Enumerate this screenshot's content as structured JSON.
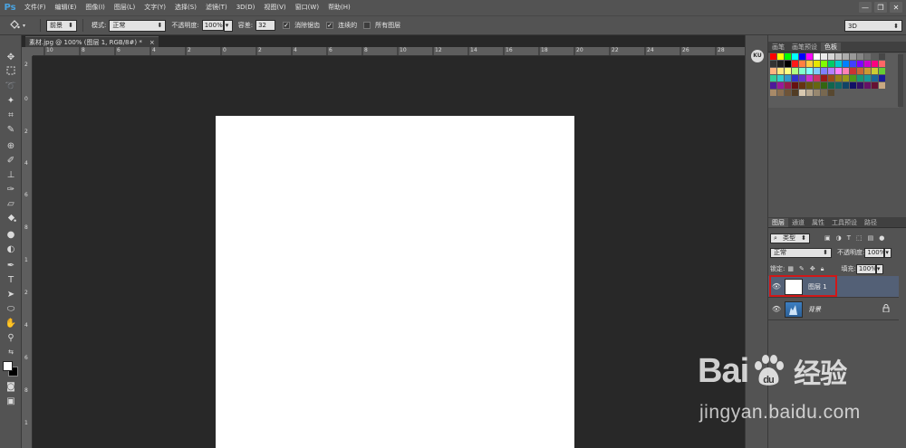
{
  "app": {
    "logo": "Ps"
  },
  "menu": [
    "文件(F)",
    "编辑(E)",
    "图像(I)",
    "图层(L)",
    "文字(Y)",
    "选择(S)",
    "滤镜(T)",
    "3D(D)",
    "视图(V)",
    "窗口(W)",
    "帮助(H)"
  ],
  "window_controls": {
    "minimize": "—",
    "restore": "❐",
    "close": "✕"
  },
  "options": {
    "fill_source": "前景",
    "mode_label": "模式:",
    "mode_value": "正常",
    "opacity_label": "不透明度:",
    "opacity_value": "100%",
    "tolerance_label": "容差:",
    "tolerance_value": "32",
    "antialias_label": "消除锯齿",
    "contiguous_label": "连续的",
    "all_layers_label": "所有图层",
    "workspace": "3D"
  },
  "document": {
    "tab_title": "素材.jpg @ 100% (图层 1, RGB/8#) *",
    "tab_close": "×",
    "ruler_top": [
      "10",
      "8",
      "6",
      "4",
      "2",
      "0",
      "2",
      "4",
      "6",
      "8",
      "10",
      "12",
      "14",
      "16",
      "18",
      "20",
      "22",
      "24",
      "26",
      "28"
    ],
    "ruler_left": [
      "2",
      "0",
      "2",
      "4",
      "6",
      "8",
      "1",
      "2",
      "4",
      "6",
      "8",
      "1"
    ]
  },
  "strip": {
    "button": "KU"
  },
  "swatches_panel": {
    "tabs": [
      "画笔",
      "画笔预设",
      "色板"
    ],
    "active_tab": "色板",
    "colors": [
      "#ff0000",
      "#ffff00",
      "#00ff00",
      "#00ffff",
      "#0000ff",
      "#ff00ff",
      "#ffffff",
      "#ebebeb",
      "#d6d6d6",
      "#c2c2c2",
      "#adadad",
      "#999999",
      "#858585",
      "#707070",
      "#5c5c5c",
      "#474747",
      "#333333",
      "#1f1f1f",
      "#000000",
      "#ff1a1a",
      "#ff8040",
      "#ffcc40",
      "#e6e600",
      "#80ff00",
      "#00cc66",
      "#00cccc",
      "#0080ff",
      "#4040ff",
      "#8000ff",
      "#cc00cc",
      "#ff0080",
      "#ff6666",
      "#ffb380",
      "#ffe680",
      "#ffff80",
      "#b3ff80",
      "#80ffcc",
      "#80ffff",
      "#80ccff",
      "#8080ff",
      "#b380ff",
      "#ff80ff",
      "#ff80b3",
      "#cc3333",
      "#cc6633",
      "#cc9933",
      "#cccc33",
      "#66cc33",
      "#33cc99",
      "#33cccc",
      "#3399cc",
      "#3333cc",
      "#6633cc",
      "#cc33cc",
      "#cc3366",
      "#991a1a",
      "#994d1a",
      "#99801a",
      "#99991a",
      "#4d991a",
      "#1a9973",
      "#1a9999",
      "#1a6699",
      "#1a1a99",
      "#4d1a99",
      "#991a99",
      "#991a4d",
      "#661111",
      "#663311",
      "#665511",
      "#666611",
      "#336611",
      "#11664d",
      "#116666",
      "#114466",
      "#111166",
      "#331166",
      "#661166",
      "#661133",
      "#c8a882",
      "#a88a68",
      "#8a6e50",
      "#6e5438",
      "#523c24",
      "#d8c8b0",
      "#b8a890",
      "#988870",
      "#786850",
      "#584830"
    ]
  },
  "layers_panel": {
    "tabs": [
      "图层",
      "通道",
      "属性",
      "工具预设",
      "路径"
    ],
    "active_tab": "图层",
    "filter_label": "类型",
    "blend_mode": "正常",
    "opacity_label": "不透明度:",
    "opacity_value": "100%",
    "lock_label": "锁定:",
    "fill_label": "填充:",
    "fill_value": "100%",
    "layers": [
      {
        "name": "图层 1",
        "selected": true
      },
      {
        "name": "背景",
        "selected": false
      }
    ]
  },
  "watermark": {
    "brand": "Bai",
    "brand2": "du",
    "cn": "经验",
    "url": "jingyan.baidu.com"
  }
}
